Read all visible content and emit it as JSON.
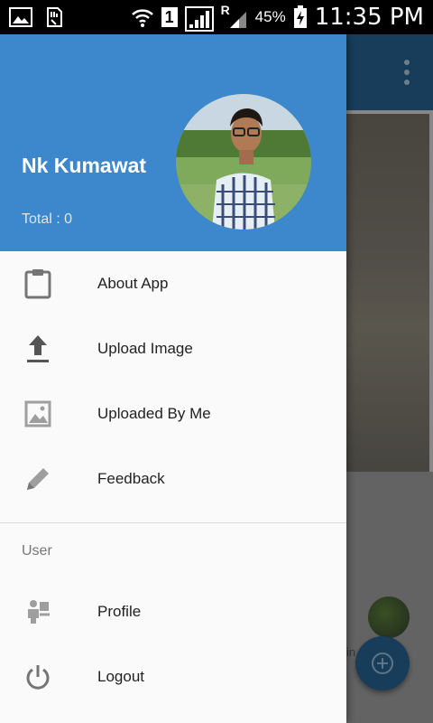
{
  "status_bar": {
    "sim_slot": "1",
    "roaming": "R",
    "battery": "45%",
    "time": "11:35 PM"
  },
  "drawer": {
    "header": {
      "name": "Nk Kumawat",
      "total": "Total : 0"
    },
    "items": [
      {
        "label": "About App",
        "icon": "clipboard-icon"
      },
      {
        "label": "Upload Image",
        "icon": "upload-icon"
      },
      {
        "label": "Uploaded By Me",
        "icon": "image-icon"
      },
      {
        "label": "Feedback",
        "icon": "pencil-icon"
      }
    ],
    "section_label": "User",
    "user_items": [
      {
        "label": "Profile",
        "icon": "profile-icon"
      },
      {
        "label": "Logout",
        "icon": "power-icon"
      }
    ]
  },
  "background": {
    "peek_text": "in"
  },
  "colors": {
    "header": "#3d87cc",
    "toolbar": "#265f8a",
    "icon": "#757575"
  }
}
